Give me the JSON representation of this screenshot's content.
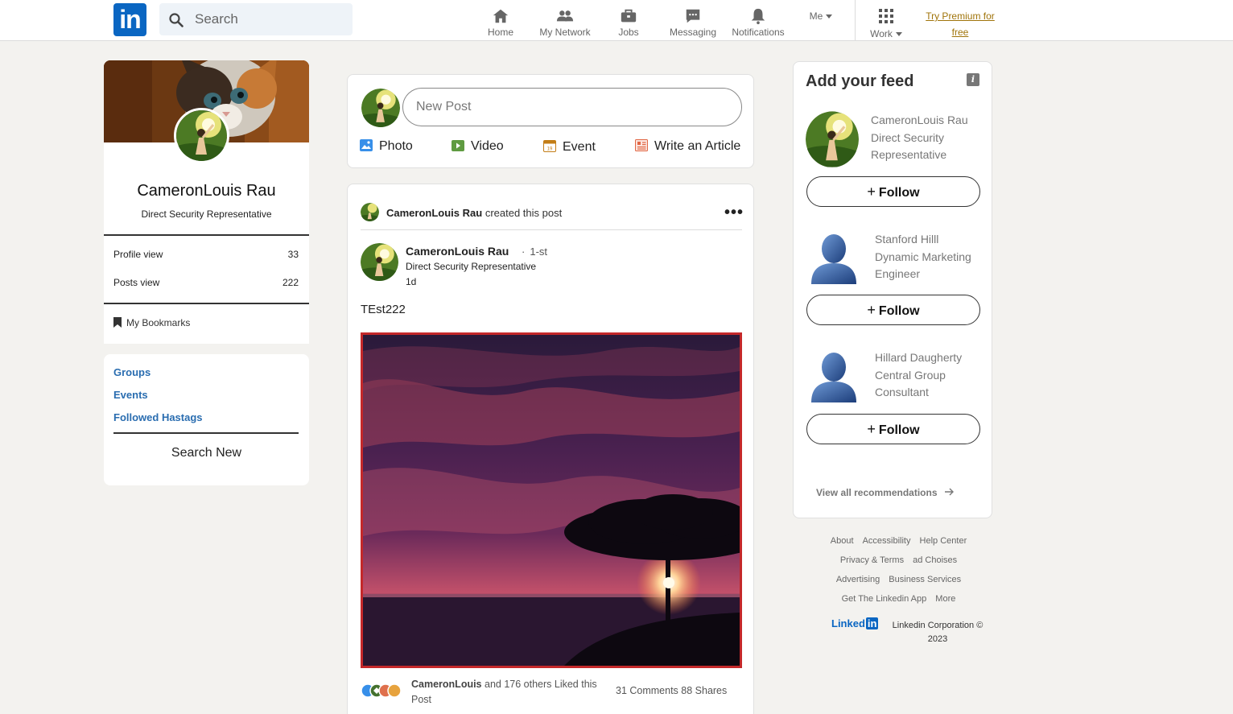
{
  "brand": {
    "logo_text": "in",
    "accent": "#0a66c2"
  },
  "search": {
    "placeholder": "Search"
  },
  "nav": [
    {
      "label": "Home",
      "icon": "home-icon"
    },
    {
      "label": "My Network",
      "icon": "network-icon"
    },
    {
      "label": "Jobs",
      "icon": "briefcase-icon"
    },
    {
      "label": "Messaging",
      "icon": "messaging-icon"
    },
    {
      "label": "Notifications",
      "icon": "bell-icon"
    },
    {
      "label": "Me",
      "icon": "caret-down-icon"
    },
    {
      "label": "Work",
      "icon": "grid-icon"
    }
  ],
  "premium": {
    "label": "Try Premium for free"
  },
  "profile": {
    "name": "CameronLouis Rau",
    "title": "Direct Security Representative",
    "stats": [
      {
        "label": "Profile view",
        "value": "33"
      },
      {
        "label": "Posts view",
        "value": "222"
      }
    ],
    "bookmarks_label": "My Bookmarks"
  },
  "left_links": {
    "items": [
      "Groups",
      "Events",
      "Followed Hastags"
    ],
    "search_new": "Search New"
  },
  "compose": {
    "placeholder": "New Post",
    "actions": [
      {
        "label": "Photo",
        "icon": "photo-icon",
        "color": "#378fe9"
      },
      {
        "label": "Video",
        "icon": "video-icon",
        "color": "#5f9b41"
      },
      {
        "label": "Event",
        "icon": "calendar-icon",
        "color": "#c37d16"
      },
      {
        "label": "Write an Article",
        "icon": "article-icon",
        "color": "#e16745"
      }
    ]
  },
  "post": {
    "created_by": "CameronLouis Rau",
    "created_suffix": "created this post",
    "author": "CameronLouis Rau",
    "degree": "1-st",
    "author_title": "Direct Security Representative",
    "time_ago": "1d",
    "text": "TEst222",
    "liked_name": "CameronLouis",
    "liked_rest": "and 176 others Liked this Post",
    "comments_shares": "31 Comments 88 Shares"
  },
  "feed": {
    "title": "Add your feed",
    "info_icon": "info-icon",
    "recommendations": [
      {
        "name": "CameronLouis Rau",
        "title": "Direct Security Representative",
        "avatar": "photo-avatar"
      },
      {
        "name": "Stanford Hilll",
        "title": "Dynamic Marketing Engineer",
        "avatar": "person-icon"
      },
      {
        "name": "Hillard Daugherty",
        "title": "Central Group Consultant",
        "avatar": "person-icon"
      }
    ],
    "follow_label": "Follow",
    "view_all": "View all recommendations"
  },
  "footer": {
    "row1": [
      "About",
      "Accessibility",
      "Help Center"
    ],
    "row2": [
      "Privacy & Terms",
      "ad Choises"
    ],
    "row3": [
      "Advertising",
      "Business Services"
    ],
    "row4": [
      "Get The Linkedin App",
      "More"
    ],
    "brand_text": "Linked",
    "brand_in": "in",
    "corp": "Linkedin Corporation © 2023"
  }
}
